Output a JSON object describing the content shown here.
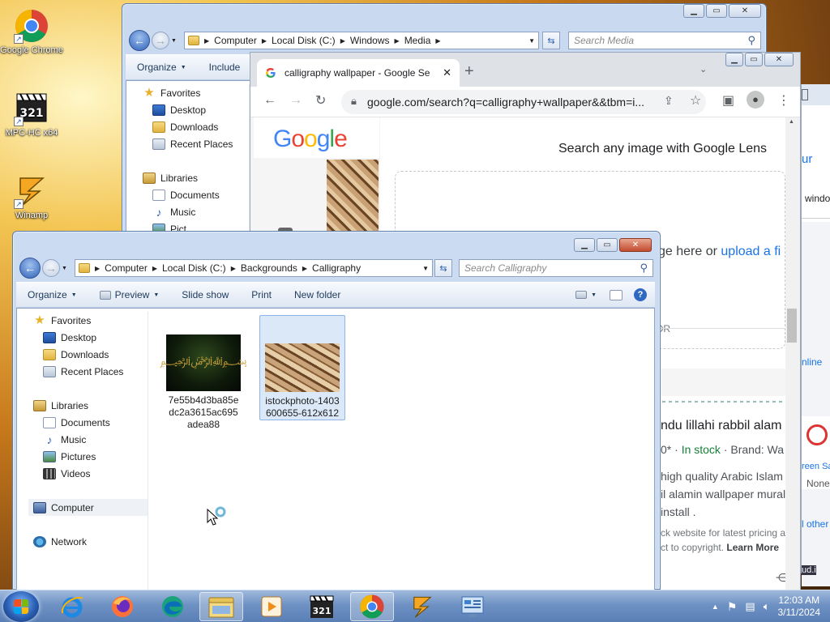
{
  "desktop": {
    "icons": [
      {
        "label": "Google Chrome"
      },
      {
        "label": "MPC-HC x64"
      },
      {
        "label": "Winamp"
      }
    ]
  },
  "explorer_back": {
    "path": [
      "Computer",
      "Local Disk (C:)",
      "Windows",
      "Media"
    ],
    "search_placeholder": "Search Media",
    "toolbar": {
      "organize": "Organize",
      "include": "Include"
    },
    "nav": {
      "favorites": "Favorites",
      "desktop": "Desktop",
      "downloads": "Downloads",
      "recent": "Recent Places",
      "libraries": "Libraries",
      "documents": "Documents",
      "music": "Music",
      "pictures": "Pict"
    }
  },
  "chrome": {
    "tab_title": "calligraphy wallpaper - Google Se",
    "url": "google.com/search?q=calligraphy+wallpaper&&tbm=i...",
    "lens_heading": "Search any image with Google Lens",
    "drop_text": "ge here or",
    "upload_link": "upload a fi",
    "or_text": "OR",
    "result_title": "ndu lillahi rabbil alam",
    "price_line": "0* · ",
    "stock": "In stock",
    "brand": " · Brand: Wa",
    "desc_lines": [
      "high quality Arabic Islam",
      "il alamin wallpaper mural",
      "install ."
    ],
    "fine_1": "ck website for latest pricing a",
    "fine_2": "ct to copyright. ",
    "learn_more": "Learn More",
    "side_texts": [
      "ur",
      "windo",
      "nline",
      "reen Sa",
      "None",
      "l other",
      "ud.i"
    ]
  },
  "explorer_front": {
    "path": [
      "Computer",
      "Local Disk (C:)",
      "Backgrounds",
      "Calligraphy"
    ],
    "search_placeholder": "Search Calligraphy",
    "toolbar": {
      "organize": "Organize",
      "preview": "Preview",
      "slideshow": "Slide show",
      "print": "Print",
      "newfolder": "New folder"
    },
    "nav": {
      "favorites": "Favorites",
      "desktop": "Desktop",
      "downloads": "Downloads",
      "recent": "Recent Places",
      "libraries": "Libraries",
      "documents": "Documents",
      "music": "Music",
      "pictures": "Pictures",
      "videos": "Videos",
      "computer": "Computer",
      "network": "Network"
    },
    "files": [
      {
        "name": "7e55b4d3ba85edc2a3615ac695adea88"
      },
      {
        "name": "istockphoto-1403600655-612x612"
      }
    ]
  },
  "taskbar": {
    "time": "12:03 AM",
    "date": "3/11/2024"
  },
  "colors": {
    "google_blue": "#4285f4",
    "google_red": "#ea4335",
    "google_yellow": "#fbbc05",
    "google_green": "#34a853",
    "link_blue": "#1a0dab",
    "stock_green": "#188038"
  }
}
